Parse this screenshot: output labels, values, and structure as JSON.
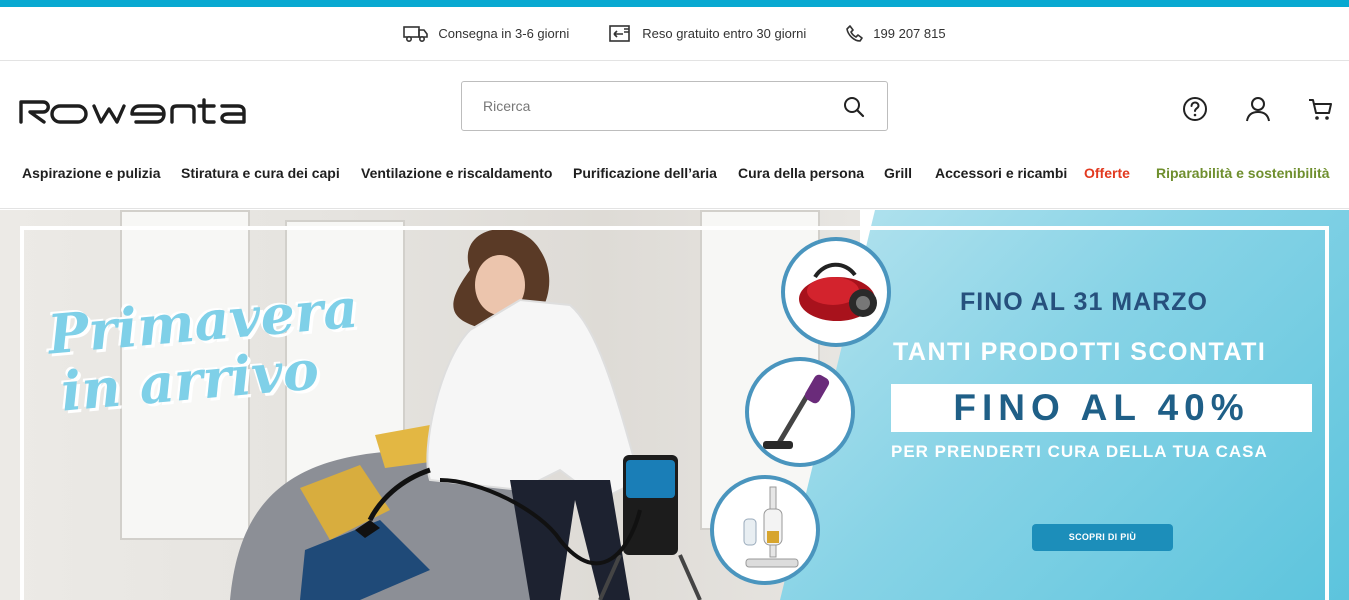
{
  "info_bar": {
    "delivery": "Consegna in 3-6 giorni",
    "returns": "Reso gratuito entro 30 giorni",
    "phone": "199 207 815"
  },
  "header": {
    "brand": "ROWENTA",
    "search_placeholder": "Ricerca",
    "icons": [
      "help-icon",
      "user-icon",
      "cart-icon"
    ]
  },
  "nav": {
    "items": [
      {
        "label": "Aspirazione e pulizia"
      },
      {
        "label": "Stiratura e cura dei capi"
      },
      {
        "label": "Ventilazione e riscaldamento"
      },
      {
        "label": "Purificazione dell’aria"
      },
      {
        "label": "Cura della persona"
      },
      {
        "label": "Grill"
      },
      {
        "label": "Accessori e ricambi"
      },
      {
        "label": "Offerte",
        "color": "#e2391f"
      },
      {
        "label": "Riparabilità e sostenibilità",
        "color": "#6f8f2e"
      }
    ]
  },
  "hero": {
    "headline_1": "Primavera",
    "headline_2": "in arrivo",
    "line_1": "FINO AL 31 MARZO",
    "line_2": "TANTI PRODOTTI SCONTATI",
    "discount": "FINO AL 40%",
    "line_3": "PER PRENDERTI CURA DELLA TUA CASA",
    "cta": "SCOPRI DI PIÙ"
  },
  "colors": {
    "accent": "#08a9d1",
    "offer": "#e2391f",
    "sustainability": "#6f8f2e",
    "promo_dark_blue": "#26507d",
    "cta_blue": "#1c8eba"
  }
}
